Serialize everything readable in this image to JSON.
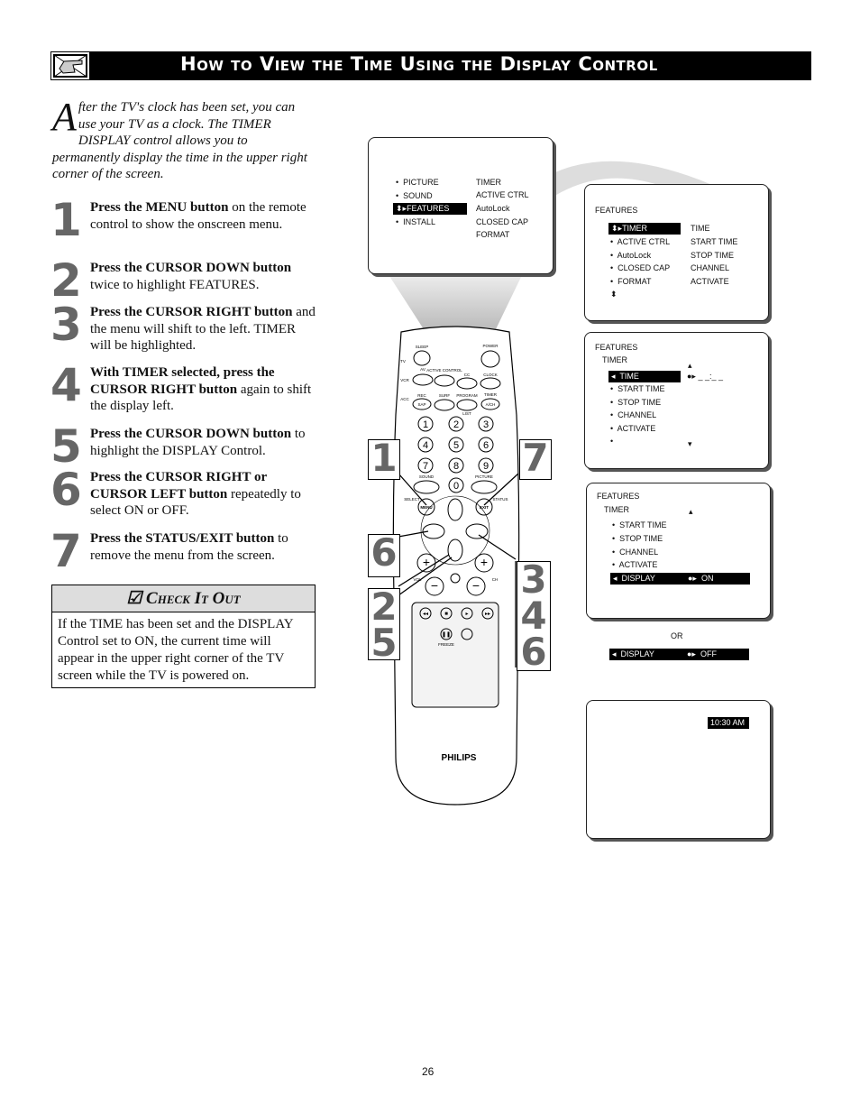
{
  "header": {
    "title": "How to View the Time Using the Display Control",
    "icon": "pointing-hand-icon"
  },
  "intro": {
    "dropcap": "A",
    "text": "fter the TV's clock has been set,  you can use your TV as a clock.  The TIMER DISPLAY control allows you to permanently display the time in the upper right corner of the screen."
  },
  "steps": [
    {
      "num": "1",
      "bold": "Press the MENU button",
      "rest": " on the remote control to show the onscreen menu."
    },
    {
      "num": "2",
      "bold": "Press the CURSOR DOWN button",
      "rest": " twice to highlight FEATURES."
    },
    {
      "num": "3",
      "bold": "Press the CURSOR RIGHT button",
      "rest": " and the menu will shift to the left. TIMER will be highlighted."
    },
    {
      "num": "4",
      "bold": "With TIMER selected, press the CURSOR RIGHT button",
      "rest": " again to shift the display left."
    },
    {
      "num": "5",
      "bold": "Press the CURSOR DOWN button",
      "rest": " to highlight the DISPLAY Control."
    },
    {
      "num": "6",
      "bold": "Press the CURSOR RIGHT or CURSOR LEFT button",
      "rest": " repeatedly to select ON or OFF."
    },
    {
      "num": "7",
      "bold": "Press the STATUS/EXIT button",
      "rest": " to remove the menu from the screen."
    }
  ],
  "check": {
    "title": "Check It Out",
    "icon": "checkbox-icon",
    "body": "If the TIME has been set and the DISPLAY Control set to ON, the current time will appear in the upper right corner of the TV screen while the TV is powered on."
  },
  "screen1": {
    "left": [
      "PICTURE",
      "SOUND",
      "FEATURES",
      "INSTALL"
    ],
    "right": [
      "TIMER",
      "ACTIVE  CTRL",
      "AutoLock",
      "CLOSED  CAP",
      "FORMAT"
    ]
  },
  "screen2": {
    "title": "FEATURES",
    "left": [
      "TIMER",
      "ACTIVE  CTRL",
      "AutoLock",
      "CLOSED  CAP",
      "FORMAT"
    ],
    "right": [
      "TIME",
      "START  TIME",
      "STOP  TIME",
      "CHANNEL",
      "ACTIVATE"
    ]
  },
  "screen3": {
    "title": "FEATURES",
    "sub": "TIMER",
    "items": [
      "TIME",
      "START  TIME",
      "STOP  TIME",
      "CHANNEL",
      "ACTIVATE"
    ],
    "value": "_ _:_ _"
  },
  "screen4": {
    "title": "FEATURES",
    "sub": "TIMER",
    "items": [
      "START  TIME",
      "STOP  TIME",
      "CHANNEL",
      "ACTIVATE"
    ],
    "selected": "DISPLAY",
    "value": "ON"
  },
  "or_label": "OR",
  "alt_bar": {
    "label": "DISPLAY",
    "value": "OFF"
  },
  "screen5": {
    "time": "10:30  AM"
  },
  "callouts": {
    "left_top": "1",
    "right_top": "7",
    "left_mid": "6",
    "left_low": [
      "2",
      "5"
    ],
    "right_low": [
      "3",
      "4",
      "6"
    ]
  },
  "remote": {
    "brand": "PHILIPS",
    "labels": {
      "sleep": "SLEEP",
      "power": "POWER",
      "tv": "TV",
      "vcr": "VCR",
      "acc": "ACC",
      "av": "AV",
      "active": "ACTIVE CONTROL",
      "cc": "CC",
      "clock": "CLOCK",
      "rec": "REC",
      "sap": "SAP",
      "surf": "SURF",
      "program": "PROGRAM",
      "list": "LIST",
      "timer": "TIMER",
      "ach": "A/CH",
      "sound": "SOUND",
      "picture": "PICTURE",
      "select": "SELECT",
      "menu": "MENU",
      "exit": "EXIT",
      "status": "STATUS",
      "vol": "VOL",
      "ch": "CH",
      "freeze": "FREEZE"
    },
    "digits": [
      "1",
      "2",
      "3",
      "4",
      "5",
      "6",
      "7",
      "8",
      "9",
      "0"
    ]
  },
  "page_number": "26"
}
